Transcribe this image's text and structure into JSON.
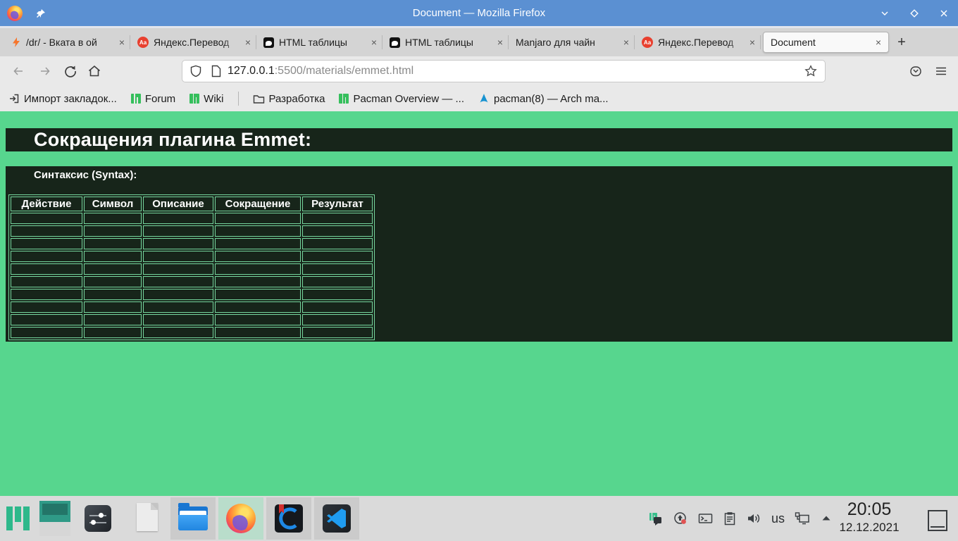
{
  "titlebar": {
    "title": "Document — Mozilla Firefox"
  },
  "tabbar": {
    "tabs": [
      {
        "label": "/dr/ - Вката в ой",
        "icon": "lightning-bolt-icon"
      },
      {
        "label": "Яндекс.Перевод",
        "icon": "yandex-translate-icon"
      },
      {
        "label": "HTML таблицы",
        "icon": "htmlbook-icon"
      },
      {
        "label": "HTML таблицы",
        "icon": "htmlbook-icon"
      },
      {
        "label": "Manjaro для чайн",
        "icon": null
      },
      {
        "label": "Яндекс.Перевод",
        "icon": "yandex-translate-icon"
      },
      {
        "label": "Document",
        "icon": null,
        "active": true
      }
    ],
    "close_glyph": "×",
    "new_tab_glyph": "+"
  },
  "navbar": {
    "url_host": "127.0.0.1",
    "url_rest": ":5500/materials/emmet.html"
  },
  "bookmarks_bar": {
    "items": [
      {
        "label": "Импорт закладок...",
        "icon": "import-bookmarks-icon"
      },
      {
        "label": "Forum",
        "icon": "manjaro-icon"
      },
      {
        "label": "Wiki",
        "icon": "manjaro-icon"
      },
      {
        "label": "Разработка",
        "icon": "folder-icon"
      },
      {
        "label": "Pacman Overview — ...",
        "icon": "manjaro-icon"
      },
      {
        "label": "pacman(8) — Arch ma...",
        "icon": "arch-linux-icon"
      }
    ]
  },
  "page": {
    "heading": "Сокращения плагина Emmet:",
    "subheading": "Синтаксис (Syntax):",
    "table": {
      "columns": [
        "Действие",
        "Символ",
        "Описание",
        "Сокращение",
        "Результат"
      ],
      "empty_row_count": 10
    }
  },
  "taskbar": {
    "keyboard_layout": "us",
    "clock_time": "20:05",
    "clock_date": "12.12.2021"
  },
  "colors": {
    "page_background": "#57d68e",
    "panel_background": "#17251a",
    "table_border": "#76d79e",
    "titlebar_blue": "#5b90d2",
    "manjaro_green": "#35bf5c",
    "arch_blue": "#1793d1"
  }
}
